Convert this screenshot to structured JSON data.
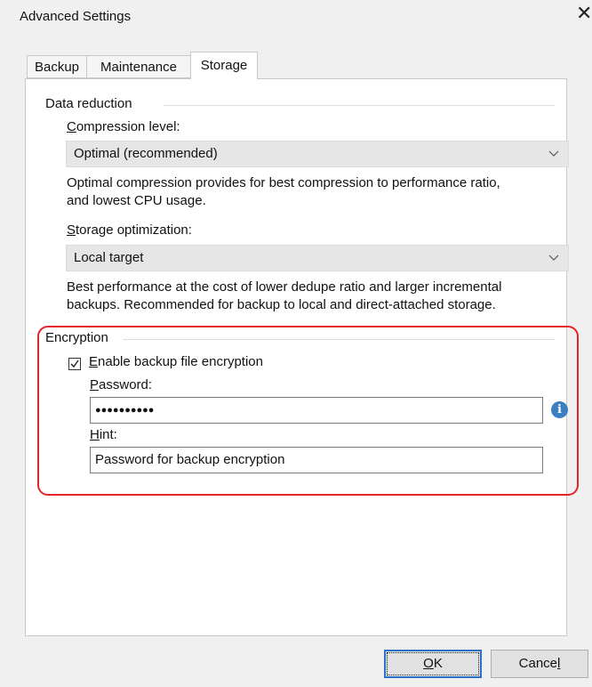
{
  "window": {
    "title": "Advanced Settings",
    "close_glyph": "✕"
  },
  "tabs": [
    {
      "label": "Backup"
    },
    {
      "label": "Maintenance"
    },
    {
      "label": "Storage",
      "active": true
    }
  ],
  "data_reduction": {
    "group_label": "Data reduction",
    "compression": {
      "label_first": "C",
      "label_rest": "ompression level:",
      "value": "Optimal (recommended)",
      "description_line1": "Optimal compression provides for best compression to performance ratio,",
      "description_line2": "and lowest CPU usage."
    },
    "storage_optimization": {
      "label_first": "S",
      "label_rest": "torage optimization:",
      "value": "Local target",
      "description_line1": "Best performance at the cost of lower dedupe ratio and larger incremental",
      "description_line2": "backups. Recommended for backup to local and direct-attached storage."
    }
  },
  "encryption": {
    "group_label": "Encryption",
    "enable_checked": true,
    "enable_label_first": "E",
    "enable_label_rest": "nable backup file encryption",
    "password_label_first": "P",
    "password_label_rest": "assword:",
    "password_value": "●●●●●●●●●●",
    "info_icon_glyph": "i",
    "hint_label_first": "H",
    "hint_label_rest": "int:",
    "hint_value": "Password for backup encryption"
  },
  "buttons": {
    "ok_first": "O",
    "ok_rest": "K",
    "cancel_first": "Cance",
    "cancel_rest": "l"
  },
  "colors": {
    "highlight_red": "#e5232b",
    "info_blue": "#3a7fc2",
    "default_button_blue": "#2b70c9"
  }
}
